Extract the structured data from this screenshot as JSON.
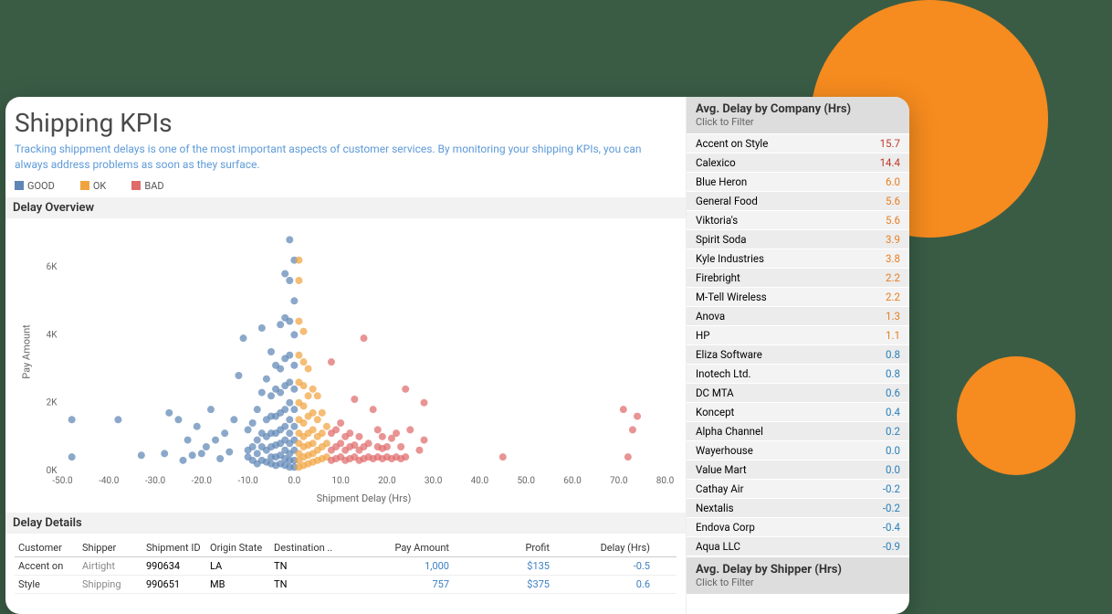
{
  "header": {
    "title": "Shipping KPIs",
    "description": "Tracking shippment delays is one of the most important aspects of customer services. By monitoring your shipping KPIs, you can always address problems as soon as they surface."
  },
  "legend": {
    "good": "GOOD",
    "ok": "OK",
    "bad": "BAD"
  },
  "colors": {
    "good": "#5e86b6",
    "ok": "#f1a340",
    "bad": "#e06b6b",
    "accent": "#f68b1f"
  },
  "sections": {
    "overview": "Delay Overview",
    "details": "Delay Details"
  },
  "chart_data": {
    "type": "scatter",
    "title": "Delay Overview",
    "xlabel": "Shipment Delay (Hrs)",
    "ylabel": "Pay Amount",
    "xlim": [
      -50,
      80
    ],
    "ylim": [
      0,
      7000
    ],
    "xticks": [
      -50,
      -40,
      -30,
      -20,
      -10,
      0,
      10,
      20,
      30,
      40,
      50,
      60,
      70,
      80
    ],
    "yticks": [
      0,
      2000,
      4000,
      6000
    ],
    "ytick_labels": [
      "0K",
      "2K",
      "4K",
      "6K"
    ],
    "series": [
      {
        "name": "GOOD",
        "color": "#5e86b6",
        "points": [
          [
            -48,
            1500
          ],
          [
            -48,
            400
          ],
          [
            -38,
            1500
          ],
          [
            -33,
            450
          ],
          [
            -28,
            500
          ],
          [
            -27,
            1700
          ],
          [
            -25,
            1500
          ],
          [
            -24,
            300
          ],
          [
            -23,
            900
          ],
          [
            -22,
            450
          ],
          [
            -21,
            1300
          ],
          [
            -20,
            500
          ],
          [
            -19,
            700
          ],
          [
            -18,
            1800
          ],
          [
            -17,
            900
          ],
          [
            -16,
            350
          ],
          [
            -15,
            1100
          ],
          [
            -14,
            550
          ],
          [
            -13,
            1500
          ],
          [
            -12,
            2800
          ],
          [
            -11,
            3900
          ],
          [
            -10,
            400
          ],
          [
            -10,
            600
          ],
          [
            -10,
            1200
          ],
          [
            -9,
            300
          ],
          [
            -9,
            700
          ],
          [
            -9,
            1400
          ],
          [
            -8,
            200
          ],
          [
            -8,
            500
          ],
          [
            -8,
            900
          ],
          [
            -8,
            1800
          ],
          [
            -7,
            300
          ],
          [
            -7,
            700
          ],
          [
            -7,
            1100
          ],
          [
            -7,
            2300
          ],
          [
            -7,
            4200
          ],
          [
            -6,
            250
          ],
          [
            -6,
            600
          ],
          [
            -6,
            1000
          ],
          [
            -6,
            1500
          ],
          [
            -6,
            2700
          ],
          [
            -5,
            200
          ],
          [
            -5,
            400
          ],
          [
            -5,
            700
          ],
          [
            -5,
            1100
          ],
          [
            -5,
            1600
          ],
          [
            -5,
            2200
          ],
          [
            -5,
            3500
          ],
          [
            -4,
            150
          ],
          [
            -4,
            400
          ],
          [
            -4,
            750
          ],
          [
            -4,
            1100
          ],
          [
            -4,
            1600
          ],
          [
            -4,
            2400
          ],
          [
            -4,
            3100
          ],
          [
            -3,
            200
          ],
          [
            -3,
            450
          ],
          [
            -3,
            800
          ],
          [
            -3,
            1200
          ],
          [
            -3,
            1700
          ],
          [
            -3,
            2300
          ],
          [
            -3,
            3000
          ],
          [
            -3,
            4300
          ],
          [
            -2,
            150
          ],
          [
            -2,
            350
          ],
          [
            -2,
            600
          ],
          [
            -2,
            900
          ],
          [
            -2,
            1300
          ],
          [
            -2,
            1800
          ],
          [
            -2,
            2500
          ],
          [
            -2,
            3300
          ],
          [
            -2,
            4500
          ],
          [
            -2,
            5800
          ],
          [
            -1,
            100
          ],
          [
            -1,
            300
          ],
          [
            -1,
            500
          ],
          [
            -1,
            800
          ],
          [
            -1,
            1100
          ],
          [
            -1,
            1500
          ],
          [
            -1,
            2000
          ],
          [
            -1,
            2600
          ],
          [
            -1,
            3400
          ],
          [
            -1,
            4400
          ],
          [
            -1,
            5600
          ],
          [
            -1,
            6800
          ],
          [
            0,
            100
          ],
          [
            0,
            300
          ],
          [
            0,
            600
          ],
          [
            0,
            900
          ],
          [
            0,
            1300
          ],
          [
            0,
            1800
          ],
          [
            0,
            2400
          ],
          [
            0,
            3100
          ],
          [
            0,
            4000
          ],
          [
            0,
            5000
          ],
          [
            0,
            6200
          ]
        ]
      },
      {
        "name": "OK",
        "color": "#f1a340",
        "points": [
          [
            1,
            100
          ],
          [
            1,
            300
          ],
          [
            1,
            500
          ],
          [
            1,
            800
          ],
          [
            1,
            1100
          ],
          [
            1,
            1500
          ],
          [
            1,
            2000
          ],
          [
            1,
            2600
          ],
          [
            1,
            3400
          ],
          [
            1,
            4400
          ],
          [
            1,
            5600
          ],
          [
            1,
            6200
          ],
          [
            2,
            150
          ],
          [
            2,
            400
          ],
          [
            2,
            700
          ],
          [
            2,
            1000
          ],
          [
            2,
            1400
          ],
          [
            2,
            1900
          ],
          [
            2,
            2500
          ],
          [
            2,
            3200
          ],
          [
            2,
            4100
          ],
          [
            3,
            200
          ],
          [
            3,
            450
          ],
          [
            3,
            750
          ],
          [
            3,
            1100
          ],
          [
            3,
            1600
          ],
          [
            3,
            2200
          ],
          [
            3,
            3000
          ],
          [
            4,
            250
          ],
          [
            4,
            500
          ],
          [
            4,
            800
          ],
          [
            4,
            1200
          ],
          [
            4,
            1700
          ],
          [
            4,
            2400
          ],
          [
            5,
            300
          ],
          [
            5,
            600
          ],
          [
            5,
            1000
          ],
          [
            5,
            1500
          ],
          [
            5,
            2200
          ],
          [
            6,
            350
          ],
          [
            6,
            700
          ],
          [
            6,
            1100
          ],
          [
            6,
            1700
          ],
          [
            7,
            400
          ],
          [
            7,
            800
          ],
          [
            7,
            1300
          ]
        ]
      },
      {
        "name": "BAD",
        "color": "#e06b6b",
        "points": [
          [
            8,
            300
          ],
          [
            8,
            600
          ],
          [
            8,
            1100
          ],
          [
            8,
            3200
          ],
          [
            9,
            350
          ],
          [
            9,
            700
          ],
          [
            9,
            1200
          ],
          [
            10,
            400
          ],
          [
            10,
            800
          ],
          [
            10,
            1400
          ],
          [
            11,
            300
          ],
          [
            11,
            600
          ],
          [
            11,
            1000
          ],
          [
            12,
            350
          ],
          [
            12,
            700
          ],
          [
            12,
            1100
          ],
          [
            13,
            400
          ],
          [
            13,
            750
          ],
          [
            13,
            2100
          ],
          [
            14,
            300
          ],
          [
            14,
            600
          ],
          [
            14,
            1000
          ],
          [
            15,
            350
          ],
          [
            15,
            700
          ],
          [
            15,
            3900
          ],
          [
            16,
            400
          ],
          [
            16,
            800
          ],
          [
            17,
            350
          ],
          [
            17,
            1800
          ],
          [
            18,
            400
          ],
          [
            18,
            700
          ],
          [
            18,
            1200
          ],
          [
            19,
            350
          ],
          [
            19,
            650
          ],
          [
            19,
            1000
          ],
          [
            20,
            400
          ],
          [
            20,
            700
          ],
          [
            21,
            350
          ],
          [
            21,
            950
          ],
          [
            22,
            400
          ],
          [
            22,
            1100
          ],
          [
            23,
            350
          ],
          [
            23,
            700
          ],
          [
            24,
            400
          ],
          [
            24,
            2400
          ],
          [
            25,
            1200
          ],
          [
            27,
            600
          ],
          [
            28,
            900
          ],
          [
            28,
            2000
          ],
          [
            45,
            400
          ],
          [
            71,
            1800
          ],
          [
            72,
            400
          ],
          [
            73,
            1200
          ],
          [
            74,
            1600
          ]
        ]
      }
    ]
  },
  "detail_table": {
    "cols": {
      "customer": "Customer",
      "shipper": "Shipper",
      "shipment_id": "Shipment ID",
      "origin": "Origin State",
      "destination": "Destination ..",
      "pay": "Pay Amount",
      "profit": "Profit",
      "delay": "Delay (Hrs)"
    },
    "rows": [
      {
        "customer": "Accent on Style",
        "shipper": "Airtight Shipping",
        "sid": "990634",
        "os": "LA",
        "ds": "TN",
        "pay": "1,000",
        "profit": "$135",
        "delay": "-0.5"
      },
      {
        "customer": "",
        "shipper": "",
        "sid": "990651",
        "os": "MB",
        "ds": "TN",
        "pay": "757",
        "profit": "$375",
        "delay": "0.6"
      }
    ]
  },
  "company_panel": {
    "title": "Avg. Delay by Company (Hrs)",
    "hint": "Click to Filter",
    "rows": [
      {
        "name": "Accent on Style",
        "val": "15.7",
        "cls": "val-red"
      },
      {
        "name": "Calexico",
        "val": "14.4",
        "cls": "val-red"
      },
      {
        "name": "Blue Heron",
        "val": "6.0",
        "cls": "val-orange"
      },
      {
        "name": "General Food",
        "val": "5.6",
        "cls": "val-orange"
      },
      {
        "name": "Viktoria's",
        "val": "5.6",
        "cls": "val-orange"
      },
      {
        "name": "Spirit Soda",
        "val": "3.9",
        "cls": "val-orange"
      },
      {
        "name": "Kyle Industries",
        "val": "3.8",
        "cls": "val-orange"
      },
      {
        "name": "Firebright",
        "val": "2.2",
        "cls": "val-orange"
      },
      {
        "name": "M-Tell Wireless",
        "val": "2.2",
        "cls": "val-orange"
      },
      {
        "name": "Anova",
        "val": "1.3",
        "cls": "val-orange"
      },
      {
        "name": "HP",
        "val": "1.1",
        "cls": "val-orange"
      },
      {
        "name": "Eliza Software",
        "val": "0.8",
        "cls": "val-blue"
      },
      {
        "name": "Inotech Ltd.",
        "val": "0.8",
        "cls": "val-blue"
      },
      {
        "name": "DC MTA",
        "val": "0.6",
        "cls": "val-blue"
      },
      {
        "name": "Koncept",
        "val": "0.4",
        "cls": "val-blue"
      },
      {
        "name": "Alpha Channel",
        "val": "0.2",
        "cls": "val-blue"
      },
      {
        "name": "Wayerhouse",
        "val": "0.0",
        "cls": "val-blue"
      },
      {
        "name": "Value Mart",
        "val": "0.0",
        "cls": "val-blue"
      },
      {
        "name": "Cathay Air",
        "val": "-0.2",
        "cls": "val-blue"
      },
      {
        "name": "Nextalis",
        "val": "-0.2",
        "cls": "val-blue"
      },
      {
        "name": "Endova Corp",
        "val": "-0.4",
        "cls": "val-blue"
      },
      {
        "name": "Aqua LLC",
        "val": "-0.9",
        "cls": "val-blue"
      }
    ]
  },
  "shipper_panel": {
    "title": "Avg. Delay by Shipper (Hrs)",
    "hint": "Click to Filter"
  }
}
